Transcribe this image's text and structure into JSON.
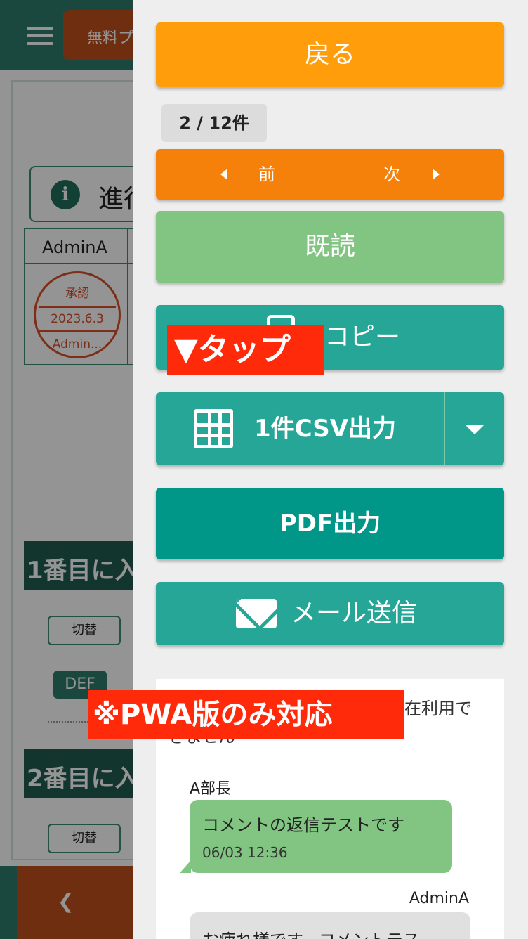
{
  "background_page": {
    "free_button": "無料プ",
    "progress_label": "進行",
    "table_header": "AdminA",
    "stamp": {
      "line1": "承認",
      "line2": "2023.6.3",
      "line3": "Admin..."
    },
    "section1": "1番目に入",
    "section2": "2番目に入",
    "toggle_label": "切替",
    "def_badge": "DEF"
  },
  "drawer": {
    "back_label": "戻る",
    "count": "2 / 12件",
    "prev_label": "前",
    "next_label": "次",
    "read_label": "既読",
    "copy_label": "コピー",
    "csv_label": "1件CSV出力",
    "pdf_label": "PDF出力",
    "mail_label": "メール送信"
  },
  "comments": {
    "note_tail": "在利用で",
    "note_line2": "きません",
    "author1": "A部長",
    "message1": "コメントの返信テストです",
    "time1": "06/03 12:36",
    "author2": "AdminA",
    "message2": "お疲れ様です。コメントテス"
  },
  "annotations": {
    "tap": "▼タップ",
    "pwa": "※PWA版のみ対応"
  },
  "colors": {
    "back_orange": "#ff9e0a",
    "nav_orange": "#f5810a",
    "read_green": "#82c583",
    "teal": "#26a696",
    "pdf_teal": "#009688",
    "annotation_red": "#ff2a0a"
  }
}
